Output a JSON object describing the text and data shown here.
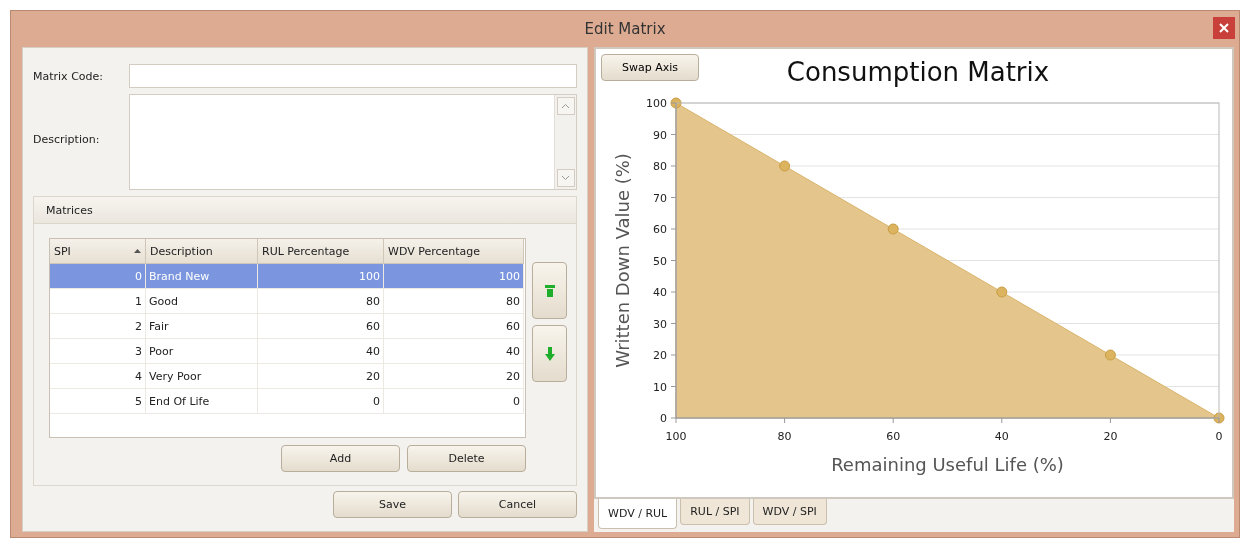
{
  "window": {
    "title": "Edit Matrix"
  },
  "form": {
    "matrix_code": {
      "label": "Matrix Code:"
    },
    "description": {
      "label": "Description:"
    }
  },
  "matrices": {
    "title": "Matrices",
    "columns": [
      {
        "label": "SPI",
        "sorted": true
      },
      {
        "label": "Description",
        "sorted": false
      },
      {
        "label": "RUL Percentage",
        "sorted": false
      },
      {
        "label": "WDV Percentage",
        "sorted": false
      }
    ],
    "rows": [
      {
        "spi": "0",
        "description": "Brand New",
        "rul": "100",
        "wdv": "100",
        "selected": true
      },
      {
        "spi": "1",
        "description": "Good",
        "rul": "80",
        "wdv": "80",
        "selected": false
      },
      {
        "spi": "2",
        "description": "Fair",
        "rul": "60",
        "wdv": "60",
        "selected": false
      },
      {
        "spi": "3",
        "description": "Poor",
        "rul": "40",
        "wdv": "40",
        "selected": false
      },
      {
        "spi": "4",
        "description": "Very Poor",
        "rul": "20",
        "wdv": "20",
        "selected": false
      },
      {
        "spi": "5",
        "description": "End Of Life",
        "rul": "0",
        "wdv": "0",
        "selected": false
      }
    ],
    "buttons": [
      "Add",
      "Delete"
    ]
  },
  "buttons": [
    "Save",
    "Cancel"
  ],
  "chart_panel": {
    "swap_button": "Swap Axis",
    "chart_data": {
      "type": "area",
      "title": "Consumption Matrix",
      "xlabel": "Remaining Useful Life (%)",
      "ylabel": "Written Down Value (%)",
      "x": [
        100,
        80,
        60,
        40,
        20,
        0
      ],
      "series": [
        {
          "color": "#e4c68c",
          "values": [
            100,
            80,
            60,
            40,
            20,
            0
          ]
        }
      ],
      "grid": true,
      "xlim": [
        100,
        0
      ],
      "ylim": [
        0,
        100
      ],
      "xticks": [
        100,
        80,
        60,
        40,
        20,
        0
      ],
      "yticks": [
        0,
        10,
        20,
        30,
        40,
        50,
        60,
        70,
        80,
        90,
        100
      ]
    },
    "tabs": [
      {
        "label": "WDV / RUL",
        "selected": true
      },
      {
        "label": "RUL / SPI",
        "selected": false
      },
      {
        "label": "WDV / SPI",
        "selected": false
      }
    ]
  }
}
